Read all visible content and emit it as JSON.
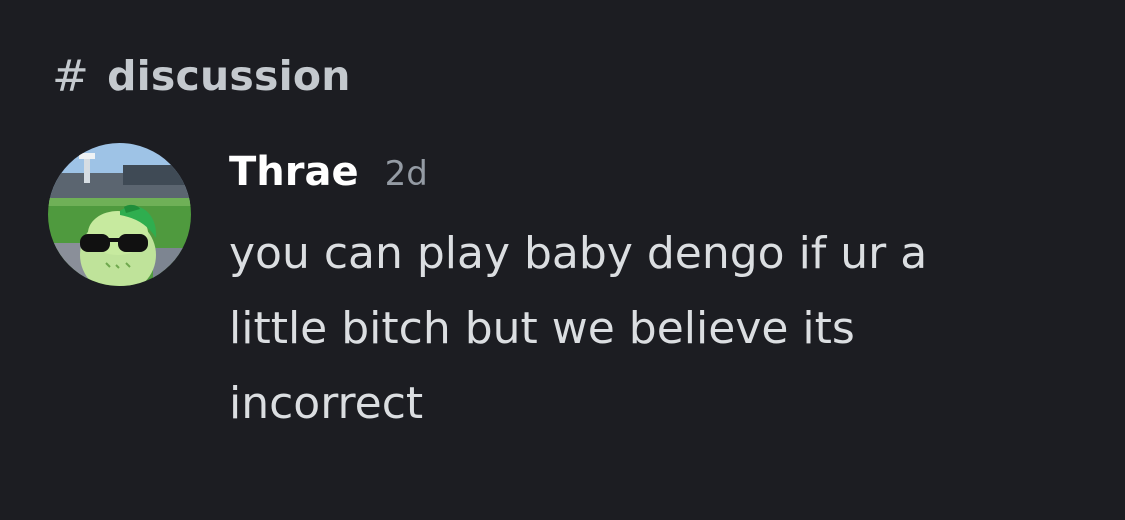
{
  "channel": {
    "hash_symbol": "#",
    "name": "discussion"
  },
  "message": {
    "author": "Thrae",
    "timestamp": "2d",
    "content": "you can play baby dengo if ur a little bitch but we believe its incorrect",
    "avatar_icon": "avatar-image"
  },
  "colors": {
    "background": "#1c1d22",
    "username": "#ffffff",
    "timestamp": "#949ba4",
    "message_text": "#dbdee1",
    "channel_text": "#c4c9ce"
  }
}
